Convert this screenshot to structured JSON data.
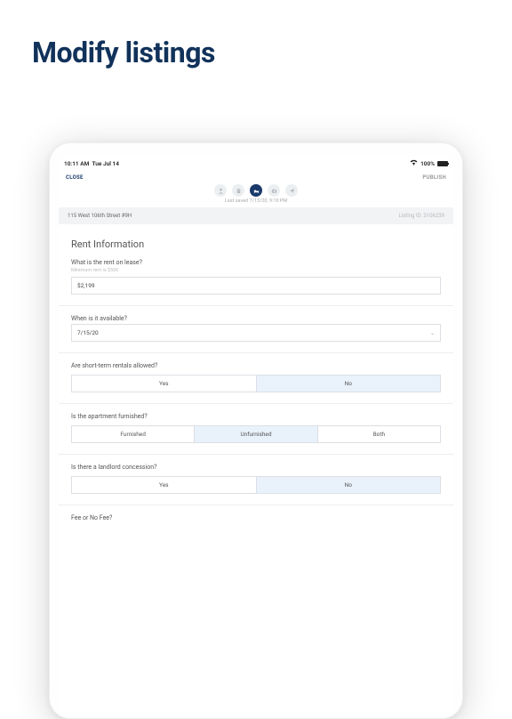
{
  "hero": {
    "title": "Modify listings"
  },
  "status": {
    "time": "10:11 AM",
    "date": "Tue Jul 14",
    "battery": "100%"
  },
  "nav": {
    "close": "CLOSE",
    "publish": "PUBLISH",
    "last_saved": "Last saved 7/13/20, 9:10 PM"
  },
  "bar": {
    "address": "115 West 106th Street #9H",
    "listing_id": "Listing ID: 3106239"
  },
  "form": {
    "section_title": "Rent Information",
    "rent": {
      "label": "What is the rent on lease?",
      "hint": "Minimum rent is $500",
      "value": "$2,199"
    },
    "available": {
      "label": "When is it available?",
      "value": "7/15/20"
    },
    "short_term": {
      "label": "Are short-term rentals allowed?",
      "yes": "Yes",
      "no": "No"
    },
    "furnished": {
      "label": "Is the apartment furnished?",
      "a": "Furnished",
      "b": "Unfurnished",
      "c": "Both"
    },
    "concession": {
      "label": "Is there a landlord concession?",
      "yes": "Yes",
      "no": "No"
    },
    "fee": {
      "label": "Fee or No Fee?"
    }
  }
}
